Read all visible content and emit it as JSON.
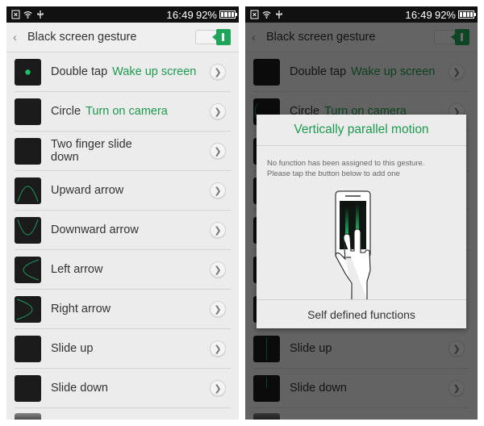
{
  "status_bar": {
    "icons": [
      "sim-icon",
      "wifi-icon",
      "usb-icon"
    ],
    "time": "16:49",
    "battery_pct": "92%",
    "battery_level": 0.92
  },
  "header": {
    "title": "Black screen gesture",
    "back_icon": "chevron-left-icon",
    "toggle_on": true
  },
  "gestures": [
    {
      "name": "Double tap",
      "function": "Wake up screen",
      "icon": "dot"
    },
    {
      "name": "Circle",
      "function": "Turn on camera",
      "icon": "circle"
    },
    {
      "name": "Two finger slide down",
      "function": "",
      "icon": "two-finger"
    },
    {
      "name": "Upward arrow",
      "function": "",
      "icon": "up-arrow"
    },
    {
      "name": "Downward arrow",
      "function": "",
      "icon": "down-arrow"
    },
    {
      "name": "Left arrow",
      "function": "",
      "icon": "left-arrow"
    },
    {
      "name": "Right arrow",
      "function": "",
      "icon": "right-arrow"
    },
    {
      "name": "Slide up",
      "function": "",
      "icon": "slide-up"
    },
    {
      "name": "Slide down",
      "function": "",
      "icon": "slide-down"
    }
  ],
  "dialog": {
    "title": "Vertically parallel motion",
    "message_line1": "No function has been assigned to this gesture.",
    "message_line2": "Please tap the button below to add one",
    "button_label": "Self defined functions",
    "illustration": "two-finger-vertical-swipe-icon"
  },
  "colors": {
    "accent_green": "#1d9a4e",
    "toggle_green": "#1fa55a",
    "status_bar_bg": "#111111",
    "screen_bg": "#ececec"
  }
}
